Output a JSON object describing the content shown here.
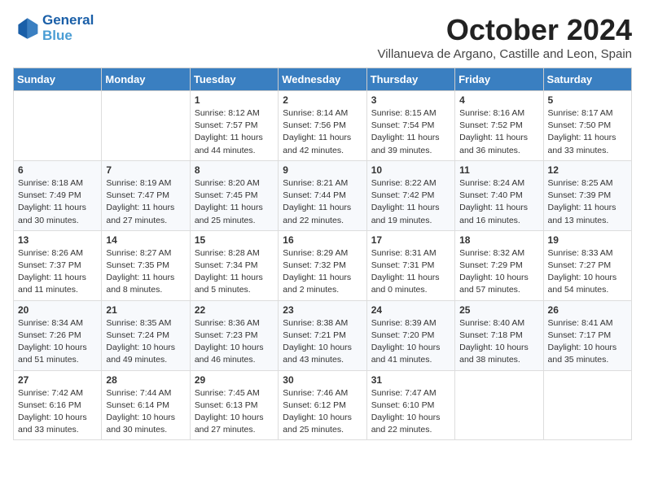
{
  "header": {
    "logo_line1": "General",
    "logo_line2": "Blue",
    "month": "October 2024",
    "location": "Villanueva de Argano, Castille and Leon, Spain"
  },
  "days_of_week": [
    "Sunday",
    "Monday",
    "Tuesday",
    "Wednesday",
    "Thursday",
    "Friday",
    "Saturday"
  ],
  "weeks": [
    [
      {
        "day": "",
        "info": ""
      },
      {
        "day": "",
        "info": ""
      },
      {
        "day": "1",
        "info": "Sunrise: 8:12 AM\nSunset: 7:57 PM\nDaylight: 11 hours and 44 minutes."
      },
      {
        "day": "2",
        "info": "Sunrise: 8:14 AM\nSunset: 7:56 PM\nDaylight: 11 hours and 42 minutes."
      },
      {
        "day": "3",
        "info": "Sunrise: 8:15 AM\nSunset: 7:54 PM\nDaylight: 11 hours and 39 minutes."
      },
      {
        "day": "4",
        "info": "Sunrise: 8:16 AM\nSunset: 7:52 PM\nDaylight: 11 hours and 36 minutes."
      },
      {
        "day": "5",
        "info": "Sunrise: 8:17 AM\nSunset: 7:50 PM\nDaylight: 11 hours and 33 minutes."
      }
    ],
    [
      {
        "day": "6",
        "info": "Sunrise: 8:18 AM\nSunset: 7:49 PM\nDaylight: 11 hours and 30 minutes."
      },
      {
        "day": "7",
        "info": "Sunrise: 8:19 AM\nSunset: 7:47 PM\nDaylight: 11 hours and 27 minutes."
      },
      {
        "day": "8",
        "info": "Sunrise: 8:20 AM\nSunset: 7:45 PM\nDaylight: 11 hours and 25 minutes."
      },
      {
        "day": "9",
        "info": "Sunrise: 8:21 AM\nSunset: 7:44 PM\nDaylight: 11 hours and 22 minutes."
      },
      {
        "day": "10",
        "info": "Sunrise: 8:22 AM\nSunset: 7:42 PM\nDaylight: 11 hours and 19 minutes."
      },
      {
        "day": "11",
        "info": "Sunrise: 8:24 AM\nSunset: 7:40 PM\nDaylight: 11 hours and 16 minutes."
      },
      {
        "day": "12",
        "info": "Sunrise: 8:25 AM\nSunset: 7:39 PM\nDaylight: 11 hours and 13 minutes."
      }
    ],
    [
      {
        "day": "13",
        "info": "Sunrise: 8:26 AM\nSunset: 7:37 PM\nDaylight: 11 hours and 11 minutes."
      },
      {
        "day": "14",
        "info": "Sunrise: 8:27 AM\nSunset: 7:35 PM\nDaylight: 11 hours and 8 minutes."
      },
      {
        "day": "15",
        "info": "Sunrise: 8:28 AM\nSunset: 7:34 PM\nDaylight: 11 hours and 5 minutes."
      },
      {
        "day": "16",
        "info": "Sunrise: 8:29 AM\nSunset: 7:32 PM\nDaylight: 11 hours and 2 minutes."
      },
      {
        "day": "17",
        "info": "Sunrise: 8:31 AM\nSunset: 7:31 PM\nDaylight: 11 hours and 0 minutes."
      },
      {
        "day": "18",
        "info": "Sunrise: 8:32 AM\nSunset: 7:29 PM\nDaylight: 10 hours and 57 minutes."
      },
      {
        "day": "19",
        "info": "Sunrise: 8:33 AM\nSunset: 7:27 PM\nDaylight: 10 hours and 54 minutes."
      }
    ],
    [
      {
        "day": "20",
        "info": "Sunrise: 8:34 AM\nSunset: 7:26 PM\nDaylight: 10 hours and 51 minutes."
      },
      {
        "day": "21",
        "info": "Sunrise: 8:35 AM\nSunset: 7:24 PM\nDaylight: 10 hours and 49 minutes."
      },
      {
        "day": "22",
        "info": "Sunrise: 8:36 AM\nSunset: 7:23 PM\nDaylight: 10 hours and 46 minutes."
      },
      {
        "day": "23",
        "info": "Sunrise: 8:38 AM\nSunset: 7:21 PM\nDaylight: 10 hours and 43 minutes."
      },
      {
        "day": "24",
        "info": "Sunrise: 8:39 AM\nSunset: 7:20 PM\nDaylight: 10 hours and 41 minutes."
      },
      {
        "day": "25",
        "info": "Sunrise: 8:40 AM\nSunset: 7:18 PM\nDaylight: 10 hours and 38 minutes."
      },
      {
        "day": "26",
        "info": "Sunrise: 8:41 AM\nSunset: 7:17 PM\nDaylight: 10 hours and 35 minutes."
      }
    ],
    [
      {
        "day": "27",
        "info": "Sunrise: 7:42 AM\nSunset: 6:16 PM\nDaylight: 10 hours and 33 minutes."
      },
      {
        "day": "28",
        "info": "Sunrise: 7:44 AM\nSunset: 6:14 PM\nDaylight: 10 hours and 30 minutes."
      },
      {
        "day": "29",
        "info": "Sunrise: 7:45 AM\nSunset: 6:13 PM\nDaylight: 10 hours and 27 minutes."
      },
      {
        "day": "30",
        "info": "Sunrise: 7:46 AM\nSunset: 6:12 PM\nDaylight: 10 hours and 25 minutes."
      },
      {
        "day": "31",
        "info": "Sunrise: 7:47 AM\nSunset: 6:10 PM\nDaylight: 10 hours and 22 minutes."
      },
      {
        "day": "",
        "info": ""
      },
      {
        "day": "",
        "info": ""
      }
    ]
  ]
}
